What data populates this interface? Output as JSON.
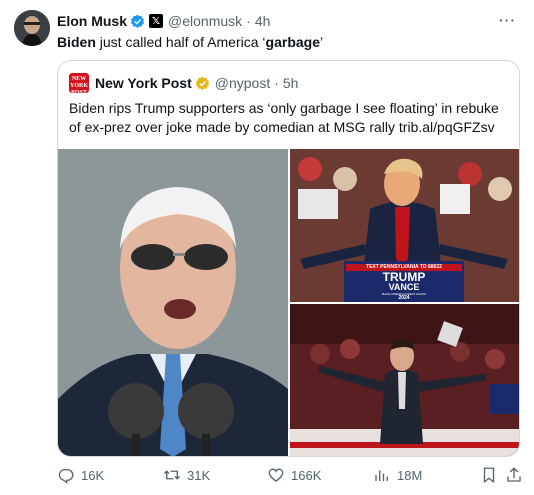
{
  "post": {
    "author_name": "Elon Musk",
    "handle": "@elonmusk",
    "separator": "·",
    "time": "4h",
    "text_bold": "Biden",
    "text_rest_1": " just called half of America ‘",
    "text_bold_2": "garbage",
    "text_rest_2": "’",
    "more_label": "···"
  },
  "quote": {
    "logo_text_1": "NEW",
    "logo_text_2": "YORK",
    "logo_text_3": "POST",
    "author_name": "New York Post",
    "handle": "@nypost",
    "separator": "·",
    "time": "5h",
    "text": "Biden rips Trump supporters as ‘only garbage I see floating’ in rebuke of ex-prez over joke made by comedian at MSG rally trib.al/pqGFZsv",
    "sign": {
      "banner": "TEXT PENNSYLVANIA TO 88022",
      "line1": "TRUMP",
      "line2": "VANCE",
      "line3": "MAKE AMERICA GREAT AGAIN!",
      "year": "2024"
    }
  },
  "actions": {
    "replies": "16K",
    "reposts": "31K",
    "likes": "166K",
    "views": "18M"
  },
  "colors": {
    "verified_blue": "#1d9bf0",
    "verified_gold": "#e2b719",
    "nypost_red": "#d4141c",
    "muted": "#536471",
    "border": "#cfd9de"
  },
  "icons": [
    "verified-badge-icon",
    "x-affiliate-icon",
    "more-icon",
    "gold-check-icon",
    "reply-icon",
    "repost-icon",
    "like-icon",
    "views-icon",
    "bookmark-icon",
    "share-icon"
  ]
}
